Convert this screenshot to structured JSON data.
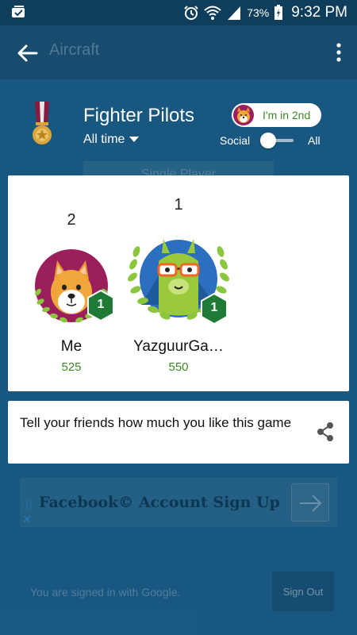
{
  "status_bar": {
    "battery_percent": "73%",
    "time": "9:32 PM",
    "icons": [
      "notification-icon",
      "alarm-icon",
      "wifi-icon",
      "signal-icon",
      "battery-icon"
    ]
  },
  "app_bar": {
    "title": "Aircraft",
    "back_icon": "arrow-left-icon",
    "menu_icon": "overflow-menu-icon"
  },
  "leaderboard": {
    "title": "Fighter Pilots",
    "time_filter": "All time",
    "rank_badge": "I'm in 2nd",
    "toggle": {
      "left_label": "Social",
      "right_label": "All",
      "selected": "Social"
    },
    "background_button": "Single Player",
    "players": [
      {
        "rank": "2",
        "name": "Me",
        "score": "525",
        "level": "1",
        "avatar": "dog-avatar"
      },
      {
        "rank": "1",
        "name": "YazguurGa…",
        "score": "550",
        "level": "1",
        "avatar": "llama-avatar"
      }
    ]
  },
  "share": {
    "text": "Tell your friends how much you like this game",
    "icon": "share-icon"
  },
  "ad": {
    "text": "Facebook© Account Sign Up",
    "info_icon": "info-icon",
    "close_label": "✕"
  },
  "footer": {
    "signed_in_text": "You are signed in with Google.",
    "sign_out_label": "Sign Out"
  },
  "colors": {
    "background": "#1e5f8c",
    "app_bar": "#174c6f",
    "score_green": "#3e8a22",
    "badge_green": "#1f7a36"
  }
}
